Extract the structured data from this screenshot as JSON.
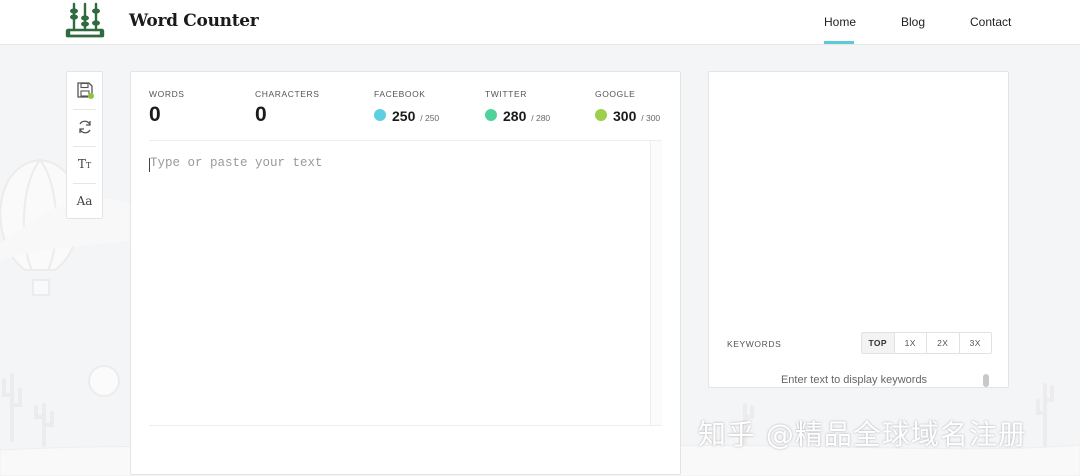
{
  "header": {
    "brand": "Word Counter",
    "nav": {
      "home": "Home",
      "blog": "Blog",
      "contact": "Contact",
      "active": "home"
    }
  },
  "toolbar": {
    "items": [
      {
        "icon": "save-icon"
      },
      {
        "icon": "refresh-icon"
      },
      {
        "icon": "text-size-icon",
        "label_big": "T",
        "label_small": "T"
      },
      {
        "icon": "font-icon",
        "label": "Aa"
      }
    ]
  },
  "stats": {
    "words": {
      "label": "WORDS",
      "value": "0"
    },
    "characters": {
      "label": "CHARACTERS",
      "value": "0"
    },
    "facebook": {
      "label": "FACEBOOK",
      "value": "250",
      "limit": "/ 250",
      "color": "#5dcfe0"
    },
    "twitter": {
      "label": "TWITTER",
      "value": "280",
      "limit": "/ 280",
      "color": "#4fd39a"
    },
    "google": {
      "label": "GOOGLE",
      "value": "300",
      "limit": "/ 300",
      "color": "#9ccf4b"
    }
  },
  "editor": {
    "placeholder": "Type or paste your text",
    "value": ""
  },
  "keywords": {
    "label": "KEYWORDS",
    "tabs": [
      "TOP",
      "1X",
      "2X",
      "3X"
    ],
    "active_tab": "TOP",
    "empty_message": "Enter text to display keywords"
  },
  "watermark": "知乎 @精品全球域名注册",
  "colors": {
    "accent": "#5ccad8",
    "logo": "#2f6b3f",
    "save_badge": "#8cc63f"
  }
}
